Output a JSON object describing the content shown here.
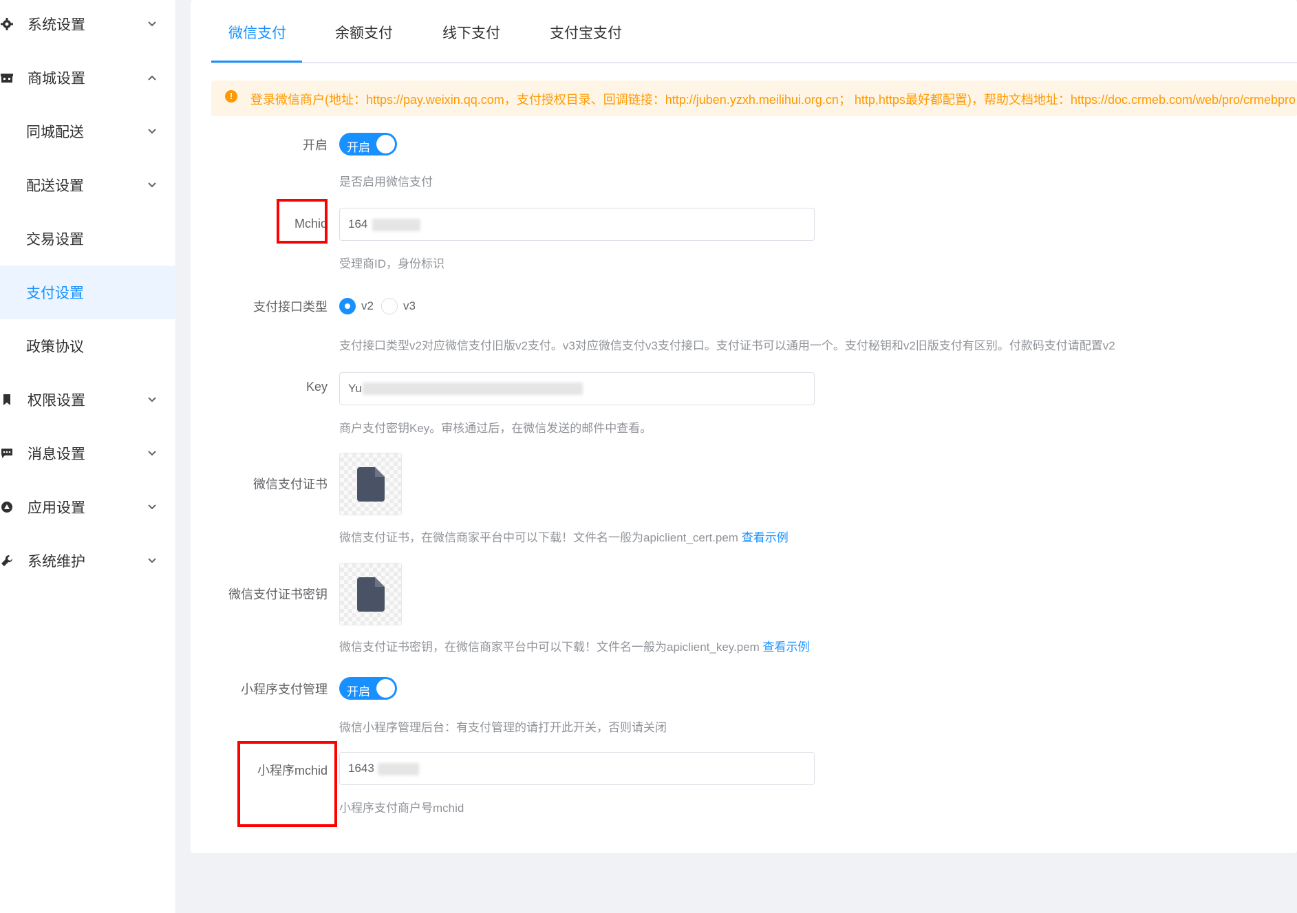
{
  "sidebar": {
    "items": [
      {
        "label": "系统设置",
        "icon": "gear-icon",
        "arrow": "down"
      },
      {
        "label": "商城设置",
        "icon": "store-icon",
        "arrow": "up"
      },
      {
        "label": "同城配送",
        "arrow": "down"
      },
      {
        "label": "配送设置",
        "arrow": "down"
      },
      {
        "label": "交易设置"
      },
      {
        "label": "支付设置",
        "active": true
      },
      {
        "label": "政策协议"
      },
      {
        "label": "权限设置",
        "icon": "bookmark-icon",
        "arrow": "down"
      },
      {
        "label": "消息设置",
        "icon": "message-icon",
        "arrow": "down"
      },
      {
        "label": "应用设置",
        "icon": "appstore-icon",
        "arrow": "down"
      },
      {
        "label": "系统维护",
        "icon": "wrench-icon",
        "arrow": "down"
      }
    ]
  },
  "tabs": [
    {
      "label": "微信支付",
      "active": true
    },
    {
      "label": "余额支付"
    },
    {
      "label": "线下支付"
    },
    {
      "label": "支付宝支付"
    }
  ],
  "alert": {
    "text": "登录微信商户(地址：https://pay.weixin.qq.com，支付授权目录、回调链接：http://juben.yzxh.meilihui.org.cn；  http,https最好都配置)，帮助文档地址：https://doc.crmeb.com/web/pro/crmebpro"
  },
  "form": {
    "enable": {
      "label": "开启",
      "switch_text": "开启",
      "help": "是否启用微信支付"
    },
    "mchid": {
      "label": "Mchid",
      "value": "164",
      "help": "受理商ID，身份标识"
    },
    "api_type": {
      "label": "支付接口类型",
      "options": [
        "v2",
        "v3"
      ],
      "selected": "v2",
      "help": "支付接口类型v2对应微信支付旧版v2支付。v3对应微信支付v3支付接口。支付证书可以通用一个。支付秘钥和v2旧版支付有区别。付款码支付请配置v2"
    },
    "key": {
      "label": "Key",
      "value": "Yu",
      "help": "商户支付密钥Key。审核通过后，在微信发送的邮件中查看。"
    },
    "cert": {
      "label": "微信支付证书",
      "help": "微信支付证书，在微信商家平台中可以下载！文件名一般为apiclient_cert.pem",
      "link": "查看示例"
    },
    "cert_key": {
      "label": "微信支付证书密钥",
      "help": "微信支付证书密钥，在微信商家平台中可以下载！文件名一般为apiclient_key.pem",
      "link": "查看示例"
    },
    "mini_pay": {
      "label": "小程序支付管理",
      "switch_text": "开启",
      "help": "微信小程序管理后台：有支付管理的请打开此开关，否则请关闭"
    },
    "mini_mchid": {
      "label": "小程序mchid",
      "value": "1643",
      "help": "小程序支付商户号mchid"
    }
  },
  "colors": {
    "primary": "#1890ff",
    "warning": "#ff9900",
    "highlight": "#ff0000"
  }
}
